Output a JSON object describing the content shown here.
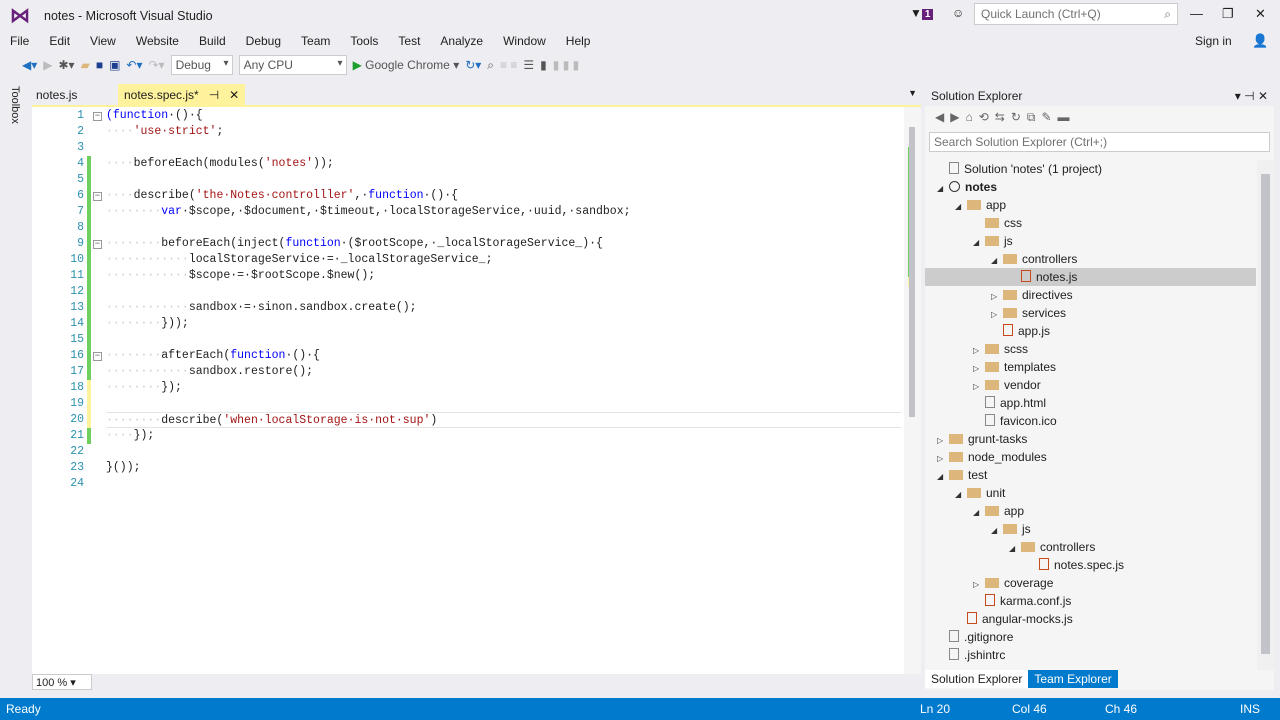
{
  "window": {
    "title": "notes - Microsoft Visual Studio",
    "quick_launch": "Quick Launch (Ctrl+Q)",
    "notif_count": "1"
  },
  "menu": [
    "File",
    "Edit",
    "View",
    "Website",
    "Build",
    "Debug",
    "Team",
    "Tools",
    "Test",
    "Analyze",
    "Window",
    "Help"
  ],
  "sign_in": "Sign in",
  "toolbar": {
    "config": "Debug",
    "platform": "Any CPU",
    "run": "Google Chrome"
  },
  "toolbox": "Toolbox",
  "tabs": [
    {
      "label": "notes.js"
    },
    {
      "label": "notes.spec.js*"
    }
  ],
  "code": [
    [
      [
        "kw",
        "(function"
      ],
      [
        "",
        "·()·{"
      ]
    ],
    [
      [
        "ws",
        "····"
      ],
      [
        "str",
        "'use·strict'"
      ],
      [
        "",
        ";"
      ]
    ],
    [],
    [
      [
        "ws",
        "····"
      ],
      [
        "",
        "beforeEach(modules("
      ],
      [
        "str",
        "'notes'"
      ],
      [
        "",
        "));"
      ]
    ],
    [],
    [
      [
        "ws",
        "····"
      ],
      [
        "",
        "describe("
      ],
      [
        "str",
        "'the·Notes·controlller'"
      ],
      [
        "",
        ",·"
      ],
      [
        "kw",
        "function"
      ],
      [
        "",
        "·()·{"
      ]
    ],
    [
      [
        "ws",
        "········"
      ],
      [
        "kw",
        "var"
      ],
      [
        "",
        "·$scope,·$document,·$timeout,·localStorageService,·uuid,·sandbox;"
      ]
    ],
    [],
    [
      [
        "ws",
        "········"
      ],
      [
        "",
        "beforeEach(inject("
      ],
      [
        "kw",
        "function"
      ],
      [
        "",
        "·($rootScope,·_localStorageService_)·{"
      ]
    ],
    [
      [
        "ws",
        "············"
      ],
      [
        "",
        "localStorageService·=·_localStorageService_;"
      ]
    ],
    [
      [
        "ws",
        "············"
      ],
      [
        "",
        "$scope·=·$rootScope.$new();"
      ]
    ],
    [],
    [
      [
        "ws",
        "············"
      ],
      [
        "",
        "sandbox·=·sinon.sandbox.create();"
      ]
    ],
    [
      [
        "ws",
        "········"
      ],
      [
        "",
        "}));"
      ]
    ],
    [],
    [
      [
        "ws",
        "········"
      ],
      [
        "",
        "afterEach("
      ],
      [
        "kw",
        "function"
      ],
      [
        "",
        "·()·{"
      ]
    ],
    [
      [
        "ws",
        "············"
      ],
      [
        "",
        "sandbox.restore();"
      ]
    ],
    [
      [
        "ws",
        "········"
      ],
      [
        "",
        "});"
      ]
    ],
    [],
    [
      [
        "ws",
        "········"
      ],
      [
        "",
        "describe("
      ],
      [
        "str",
        "'when·localStorage·is·not·sup'"
      ],
      [
        "",
        ")"
      ]
    ],
    [
      [
        "ws",
        "····"
      ],
      [
        "",
        "});"
      ]
    ],
    [],
    [
      [
        "",
        "}());"
      ]
    ],
    []
  ],
  "zoom": "100 %",
  "solution_explorer": {
    "title": "Solution Explorer",
    "search": "Search Solution Explorer (Ctrl+;)",
    "tree": [
      {
        "l": 0,
        "t": "Solution 'notes' (1 project)",
        "i": "plain",
        "a": ""
      },
      {
        "l": 0,
        "t": "notes",
        "i": "globe",
        "a": "▲",
        "b": true
      },
      {
        "l": 1,
        "t": "app",
        "i": "folder",
        "a": "▲"
      },
      {
        "l": 2,
        "t": "css",
        "i": "folder",
        "a": ""
      },
      {
        "l": 2,
        "t": "js",
        "i": "folder",
        "a": "▲"
      },
      {
        "l": 3,
        "t": "controllers",
        "i": "folder",
        "a": "▲"
      },
      {
        "l": 4,
        "t": "notes.js",
        "i": "file",
        "a": "",
        "s": true
      },
      {
        "l": 3,
        "t": "directives",
        "i": "folder",
        "a": "▷"
      },
      {
        "l": 3,
        "t": "services",
        "i": "folder",
        "a": "▷"
      },
      {
        "l": 3,
        "t": "app.js",
        "i": "file",
        "a": ""
      },
      {
        "l": 2,
        "t": "scss",
        "i": "folder",
        "a": "▷"
      },
      {
        "l": 2,
        "t": "templates",
        "i": "folder",
        "a": "▷"
      },
      {
        "l": 2,
        "t": "vendor",
        "i": "folder",
        "a": "▷"
      },
      {
        "l": 2,
        "t": "app.html",
        "i": "plain",
        "a": ""
      },
      {
        "l": 2,
        "t": "favicon.ico",
        "i": "plain",
        "a": ""
      },
      {
        "l": 0,
        "t": "grunt-tasks",
        "i": "folder",
        "a": "▷"
      },
      {
        "l": 0,
        "t": "node_modules",
        "i": "folder",
        "a": "▷"
      },
      {
        "l": 0,
        "t": "test",
        "i": "folder",
        "a": "▲"
      },
      {
        "l": 1,
        "t": "unit",
        "i": "folder",
        "a": "▲"
      },
      {
        "l": 2,
        "t": "app",
        "i": "folder",
        "a": "▲"
      },
      {
        "l": 3,
        "t": "js",
        "i": "folder",
        "a": "▲"
      },
      {
        "l": 4,
        "t": "controllers",
        "i": "folder",
        "a": "▲"
      },
      {
        "l": 5,
        "t": "notes.spec.js",
        "i": "file",
        "a": ""
      },
      {
        "l": 2,
        "t": "coverage",
        "i": "folder",
        "a": "▷"
      },
      {
        "l": 2,
        "t": "karma.conf.js",
        "i": "file",
        "a": ""
      },
      {
        "l": 1,
        "t": "angular-mocks.js",
        "i": "file",
        "a": ""
      },
      {
        "l": 0,
        "t": ".gitignore",
        "i": "plain",
        "a": ""
      },
      {
        "l": 0,
        "t": ".jshintrc",
        "i": "plain",
        "a": ""
      }
    ],
    "tabs": [
      "Solution Explorer",
      "Team Explorer"
    ]
  },
  "status": {
    "state": "Ready",
    "ln": "Ln 20",
    "col": "Col 46",
    "ch": "Ch 46",
    "mode": "INS"
  }
}
